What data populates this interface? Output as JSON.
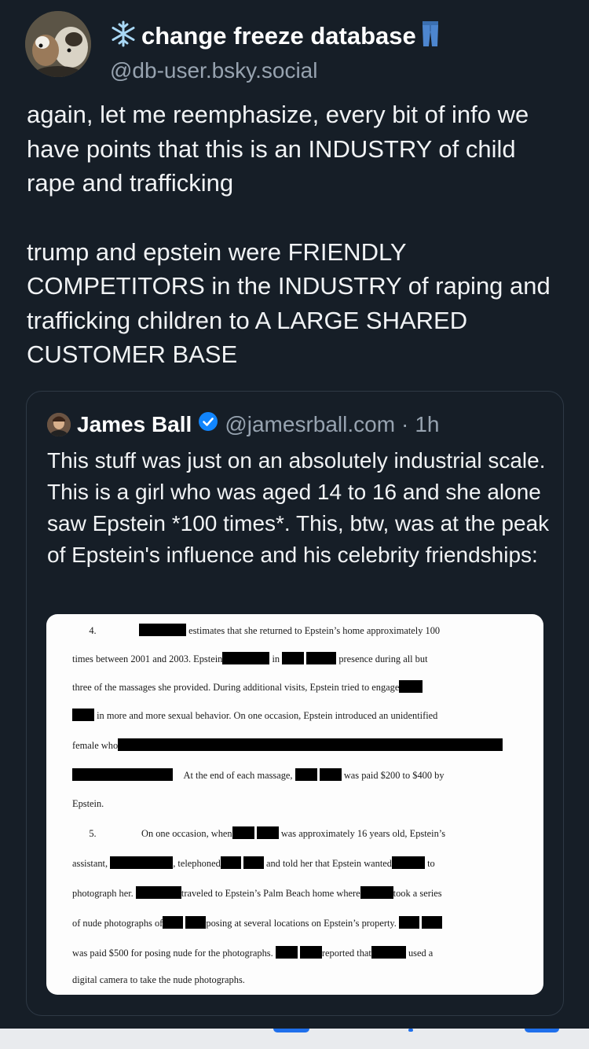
{
  "post": {
    "author": {
      "display_name": "change freeze database",
      "handle": "@db-user.bsky.social",
      "prefix_icon": "snowflake-icon",
      "suffix_icon": "jeans-icon"
    },
    "paragraphs": [
      "again, let me reemphasize, every bit of info we have points that this is an INDUSTRY of child rape and trafficking",
      "trump and epstein were FRIENDLY COMPETITORS in the INDUSTRY of raping and trafficking children to A LARGE SHARED CUSTOMER BASE"
    ]
  },
  "quote": {
    "author_name": "James Ball",
    "verified_icon": "verified-check-icon",
    "handle": "@jamesrball.com",
    "separator": "·",
    "time": "1h",
    "text": "This stuff was just on an absolutely industrial scale. This is a girl who was aged 14 to 16 and she alone saw Epstein *100 times*. This, btw, was at the peak of Epstein's influence and his celebrity friendships:"
  },
  "document": {
    "l1_num": "4.",
    "l1_a": "estimates that she returned to Epstein’s home approximately 100",
    "l2_a": "times between 2001 and 2003.  Epstein",
    "l2_b": "in",
    "l2_c": "presence during all but",
    "l3_a": "three of the massages she provided.  During additional visits, Epstein tried to engage",
    "l4_a": "in more and more sexual behavior.  On one occasion, Epstein introduced an unidentified",
    "l5_a": "female who",
    "l6_a": "At the end of each massage,",
    "l6_b": "was paid $200 to $400 by",
    "l7_a": "Epstein.",
    "l8_num": "5.",
    "l8_a": "On one occasion, when",
    "l8_b": "was approximately 16 years old, Epstein’s",
    "l9_a": "assistant,",
    "l9_b": ", telephoned",
    "l9_c": "and told her that Epstein wanted",
    "l9_d": "to",
    "l10_a": "photograph her.",
    "l10_b": "traveled to Epstein’s Palm Beach home where",
    "l10_c": "took a series",
    "l11_a": "of nude photographs of",
    "l11_b": "posing at several locations on Epstein’s property.",
    "l12_a": "was paid $500 for posing nude for the photographs.",
    "l12_b": "reported that",
    "l12_c": "used a",
    "l13_a": "digital camera to take the nude photographs."
  },
  "colors": {
    "background": "#161e27",
    "secondary_text": "#97a3b0",
    "accent": "#1f6feb",
    "verified": "#1185fe"
  }
}
